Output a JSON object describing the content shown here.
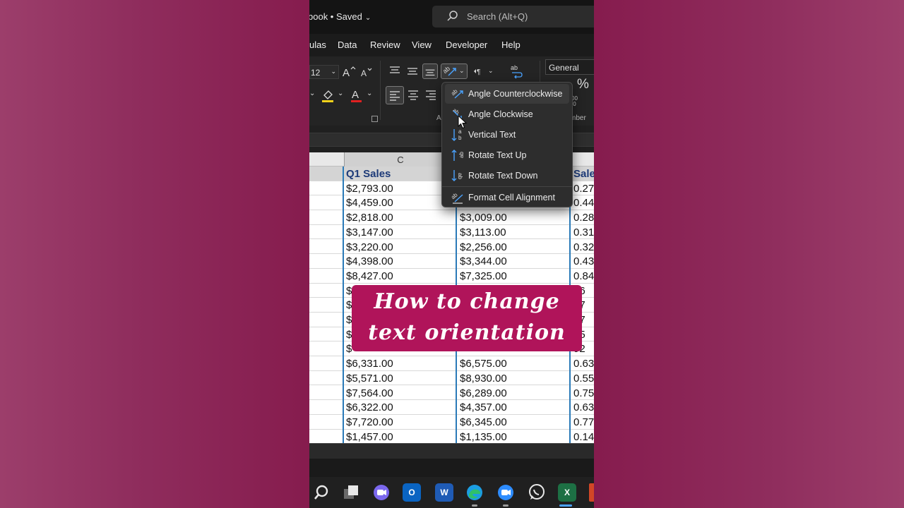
{
  "titlebar": {
    "doc_title": "book • Saved",
    "search_placeholder": "Search (Alt+Q)"
  },
  "tabs": [
    "ulas",
    "Data",
    "Review",
    "View",
    "Developer",
    "Help"
  ],
  "ribbon": {
    "font_size": "12",
    "number_format": "General",
    "percent_symbol": "%",
    "group_label_alignment": "A",
    "group_label_number": "mber",
    "decimal_fragment": "00\n.0"
  },
  "sheet": {
    "column_letter": "C",
    "header": [
      "Q1 Sales",
      "",
      "Sale"
    ],
    "rows": [
      [
        "$2,793.00",
        "",
        "0.27"
      ],
      [
        "$4,459.00",
        "",
        "0.44"
      ],
      [
        "$2,818.00",
        "$3,009.00",
        "0.28"
      ],
      [
        "$3,147.00",
        "$3,113.00",
        "0.31"
      ],
      [
        "$3,220.00",
        "$2,256.00",
        "0.32"
      ],
      [
        "$4,398.00",
        "$3,344.00",
        "0.43"
      ],
      [
        "$8,427.00",
        "$7,325.00",
        "0.84"
      ],
      [
        "$",
        "",
        "46"
      ],
      [
        "$",
        "",
        "47"
      ],
      [
        "$",
        "",
        "27"
      ],
      [
        "$",
        "",
        "45"
      ],
      [
        "$",
        "",
        "92"
      ],
      [
        "$6,331.00",
        "$6,575.00",
        "0.63"
      ],
      [
        "$5,571.00",
        "$8,930.00",
        "0.55"
      ],
      [
        "$7,564.00",
        "$6,289.00",
        "0.75"
      ],
      [
        "$6,322.00",
        "$4,357.00",
        "0.63"
      ],
      [
        "$7,720.00",
        "$6,345.00",
        "0.77"
      ],
      [
        "$1,457.00",
        "$1,135.00",
        "0.14"
      ]
    ]
  },
  "orientation_menu": {
    "items": [
      {
        "label": "Angle Counterclockwise",
        "icon": "angle-counterclockwise-icon"
      },
      {
        "label": "Angle Clockwise",
        "icon": "angle-clockwise-icon"
      },
      {
        "label": "Vertical Text",
        "icon": "vertical-text-icon"
      },
      {
        "label": "Rotate Text Up",
        "icon": "rotate-text-up-icon"
      },
      {
        "label": "Rotate Text Down",
        "icon": "rotate-text-down-icon"
      },
      {
        "label": "Format Cell Alignment",
        "icon": "format-cell-alignment-icon"
      }
    ]
  },
  "caption": {
    "line1": "How to change",
    "line2": "text orientation"
  },
  "taskbar": {
    "icons": [
      "search-icon",
      "task-view-icon",
      "teams-chat-icon",
      "outlook-icon",
      "word-icon",
      "edge-icon",
      "zoom-icon",
      "whatsapp-icon",
      "excel-icon"
    ],
    "outlook_letter": "O",
    "word_letter": "W",
    "excel_letter": "X"
  },
  "colors": {
    "background": "#861c4e",
    "caption_bg": "#b0145a",
    "header_text": "#1d3a78",
    "column_border": "#2a7ab8",
    "excel_green": "#1d7044"
  }
}
